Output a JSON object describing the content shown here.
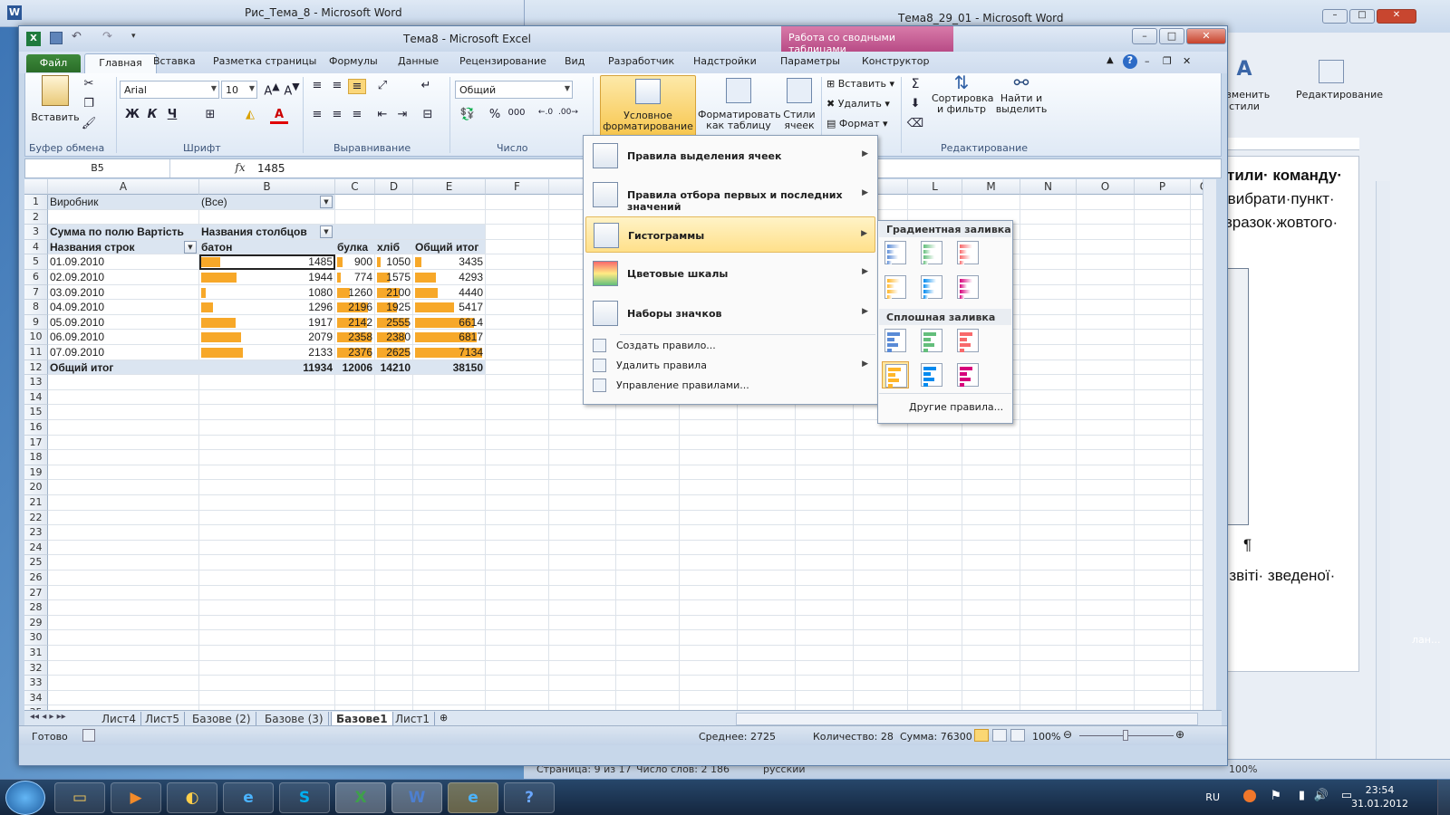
{
  "word_bg": {
    "title1": "Рис_Тема_8 - Microsoft Word",
    "title2": "Тема8_29_01 - Microsoft Word",
    "ribbon_styles": "Изменить стили",
    "ribbon_edit": "Редактирование",
    "text_lines": [
      "тили· команду·",
      "·вибрати·пункт·",
      "зразок·жовтого·",
      "¶",
      "· звіті· зведеної·"
    ],
    "status_page": "Страница: 9 из 17",
    "status_words": "Число слов: 2 186",
    "status_lang": "русский",
    "status_zoom": "100%",
    "side_text": "лан..."
  },
  "excel": {
    "title": "Тема8 - Microsoft Excel",
    "pivot_tools": "Работа со сводными таблицами",
    "tabs": [
      "Файл",
      "Главная",
      "Вставка",
      "Разметка страницы",
      "Формулы",
      "Данные",
      "Рецензирование",
      "Вид",
      "Разработчик",
      "Надстройки"
    ],
    "pivot_tabs": [
      "Параметры",
      "Конструктор"
    ],
    "ribbon": {
      "paste": "Вставить",
      "clipboard": "Буфер обмена",
      "font_name": "Arial",
      "font_size": "10",
      "font_group": "Шрифт",
      "bold": "Ж",
      "italic": "К",
      "underline": "Ч",
      "align_group": "Выравнивание",
      "number_format": "Общий",
      "number_group": "Число",
      "cf": "Условное форматирование",
      "cf_line1": "Условное",
      "cf_line2": "форматирование",
      "fmt_table_line1": "Форматировать",
      "fmt_table_line2": "как таблицу",
      "cell_styles_line1": "Стили",
      "cell_styles_line2": "ячеек",
      "insert": "Вставить",
      "delete": "Удалить",
      "format": "Формат",
      "sort_line1": "Сортировка",
      "sort_line2": "и фильтр",
      "find_line1": "Найти и",
      "find_line2": "выделить",
      "edit_group": "Редактирование"
    },
    "name_box": "B5",
    "fx": "fx",
    "formula_value": "1485",
    "columns_left": [
      "A",
      "B",
      "C",
      "D",
      "E",
      "F"
    ],
    "columns_right": [
      "L",
      "M",
      "N",
      "O",
      "P",
      "Q"
    ],
    "rows": [
      "1",
      "2",
      "3",
      "4",
      "5",
      "6",
      "7",
      "8",
      "9",
      "10",
      "11",
      "12",
      "13",
      "14",
      "15",
      "16",
      "17",
      "18",
      "19",
      "20",
      "21",
      "22",
      "23",
      "24",
      "25",
      "26",
      "27",
      "28",
      "29",
      "30",
      "31",
      "32",
      "33",
      "34",
      "35"
    ],
    "pivot": {
      "filter_label": "Виробник",
      "filter_value": "(Все)",
      "sum_label": "Сумма по полю Вартість",
      "col_label": "Названия столбцов",
      "row_label": "Названия строк",
      "headers": [
        "батон",
        "булка",
        "хліб",
        "Общий итог"
      ],
      "dates": [
        "01.09.2010",
        "02.09.2010",
        "03.09.2010",
        "04.09.2010",
        "05.09.2010",
        "06.09.2010",
        "07.09.2010"
      ],
      "baton": [
        1485,
        1944,
        1080,
        1296,
        1917,
        2079,
        2133
      ],
      "bulka": [
        900,
        774,
        1260,
        2196,
        2142,
        2358,
        2376
      ],
      "khlib": [
        1050,
        1575,
        2100,
        1925,
        2555,
        2380,
        2625
      ],
      "total": [
        3435,
        4293,
        4440,
        5417,
        6614,
        6817,
        7134
      ],
      "grand_label": "Общий итог",
      "grand": [
        11934,
        12006,
        14210,
        38150
      ]
    },
    "sheet_tabs": [
      "Лист4",
      "Лист5",
      "Базове (2)",
      "Базове (3)",
      "Базове1",
      "Лист1"
    ],
    "active_sheet": "Базове1",
    "status": {
      "ready": "Готово",
      "average": "Среднее: 2725",
      "count": "Количество: 28",
      "sum": "Сумма: 76300",
      "zoom": "100%"
    }
  },
  "cf_menu": {
    "items": [
      "Правила выделения ячеек",
      "Правила отбора первых и последних значений",
      "Гистограммы",
      "Цветовые шкалы",
      "Наборы значков"
    ],
    "small_items": [
      "Создать правило...",
      "Удалить правила",
      "Управление правилами..."
    ]
  },
  "submenu": {
    "gradient": "Градиентная заливка",
    "solid": "Сплошная заливка",
    "more": "Другие правила..."
  },
  "colors": {
    "bar_fill": "#f7a829",
    "accent_cf": "#f7c54b",
    "pivot_tools": "#c55d95"
  },
  "taskbar": {
    "lang": "RU",
    "time": "23:54",
    "date": "31.01.2012",
    "apps": [
      "folder-icon",
      "media-player-icon",
      "paint-icon",
      "ie-icon",
      "skype-icon",
      "excel-icon",
      "word-icon",
      "ie-icon",
      "help-icon"
    ]
  }
}
